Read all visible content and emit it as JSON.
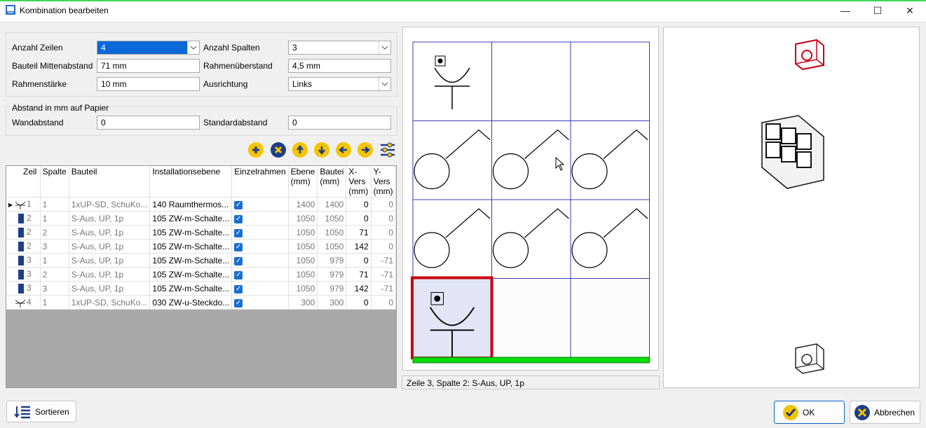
{
  "window": {
    "title": "Kombination bearbeiten",
    "minimize": "—",
    "maximize": "☐",
    "close": "✕"
  },
  "settings": {
    "rows_label": "Anzahl Zeilen",
    "rows_value": "4",
    "cols_label": "Anzahl Spalten",
    "cols_value": "3",
    "spacing_label": "Bauteil Mittenabstand",
    "spacing_value": "71 mm",
    "frame_gap_label": "Rahmenüberstand",
    "frame_gap_value": "4,5 mm",
    "frame_thick_label": "Rahmenstärke",
    "frame_thick_value": "10 mm",
    "align_label": "Ausrichtung",
    "align_value": "Links"
  },
  "distance": {
    "group_label": "Abstand in mm auf Papier",
    "wall_label": "Wandabstand",
    "wall_value": "0",
    "std_label": "Standardabstand",
    "std_value": "0"
  },
  "toolbar": [
    "add-icon",
    "remove-icon",
    "arrow-up-icon",
    "arrow-down-icon",
    "arrow-left-icon",
    "arrow-right-icon",
    "settings-sliders-icon"
  ],
  "colors": {
    "toolbar_yellow": "#f5c400",
    "toolbar_blue": "#1f3d8a",
    "selection": "#c80010",
    "green_bar": "#00dd00",
    "grid_line": "#3a3ab8"
  },
  "table": {
    "headers": [
      "Zeil",
      "Spalte",
      "Bauteil",
      "Installationsebene",
      "Einzelrahmen",
      "Ebene (mm)",
      "Bautei (mm)",
      "X-Vers (mm)",
      "Y-Vers (mm)"
    ],
    "rows": [
      {
        "icon": "socket",
        "zeile": "1",
        "spalte": "1",
        "bauteil": "1xUP-SD, SchuKo...",
        "ebene": "140 Raumthermos...",
        "einzel": "✓",
        "e": "1400",
        "b": "1400",
        "x": "0",
        "y": "0"
      },
      {
        "icon": "switch",
        "zeile": "2",
        "spalte": "1",
        "bauteil": "S-Aus, UP, 1p",
        "ebene": "105 ZW-m-Schalte...",
        "einzel": "✓",
        "e": "1050",
        "b": "1050",
        "x": "0",
        "y": "0"
      },
      {
        "icon": "switch",
        "zeile": "2",
        "spalte": "2",
        "bauteil": "S-Aus, UP, 1p",
        "ebene": "105 ZW-m-Schalte...",
        "einzel": "✓",
        "e": "1050",
        "b": "1050",
        "x": "71",
        "y": "0"
      },
      {
        "icon": "switch",
        "zeile": "2",
        "spalte": "3",
        "bauteil": "S-Aus, UP, 1p",
        "ebene": "105 ZW-m-Schalte...",
        "einzel": "✓",
        "e": "1050",
        "b": "1050",
        "x": "142",
        "y": "0"
      },
      {
        "icon": "switch",
        "zeile": "3",
        "spalte": "1",
        "bauteil": "S-Aus, UP, 1p",
        "ebene": "105 ZW-m-Schalte...",
        "einzel": "✓",
        "e": "1050",
        "b": "979",
        "x": "0",
        "y": "-71"
      },
      {
        "icon": "switch",
        "zeile": "3",
        "spalte": "2",
        "bauteil": "S-Aus, UP, 1p",
        "ebene": "105 ZW-m-Schalte...",
        "einzel": "✓",
        "e": "1050",
        "b": "979",
        "x": "71",
        "y": "-71"
      },
      {
        "icon": "switch",
        "zeile": "3",
        "spalte": "3",
        "bauteil": "S-Aus, UP, 1p",
        "ebene": "105 ZW-m-Schalte...",
        "einzel": "✓",
        "e": "1050",
        "b": "979",
        "x": "142",
        "y": "-71"
      },
      {
        "icon": "socket",
        "zeile": "4",
        "spalte": "1",
        "bauteil": "1xUP-SD, SchuKo...",
        "ebene": "030 ZW-u-Steckdo...",
        "einzel": "✓",
        "e": "300",
        "b": "300",
        "x": "0",
        "y": "0"
      }
    ]
  },
  "status": "Zeile 3, Spalte 2: S-Aus, UP, 1p",
  "buttons": {
    "sort": "Sortieren",
    "ok": "OK",
    "cancel": "Abbrechen"
  }
}
